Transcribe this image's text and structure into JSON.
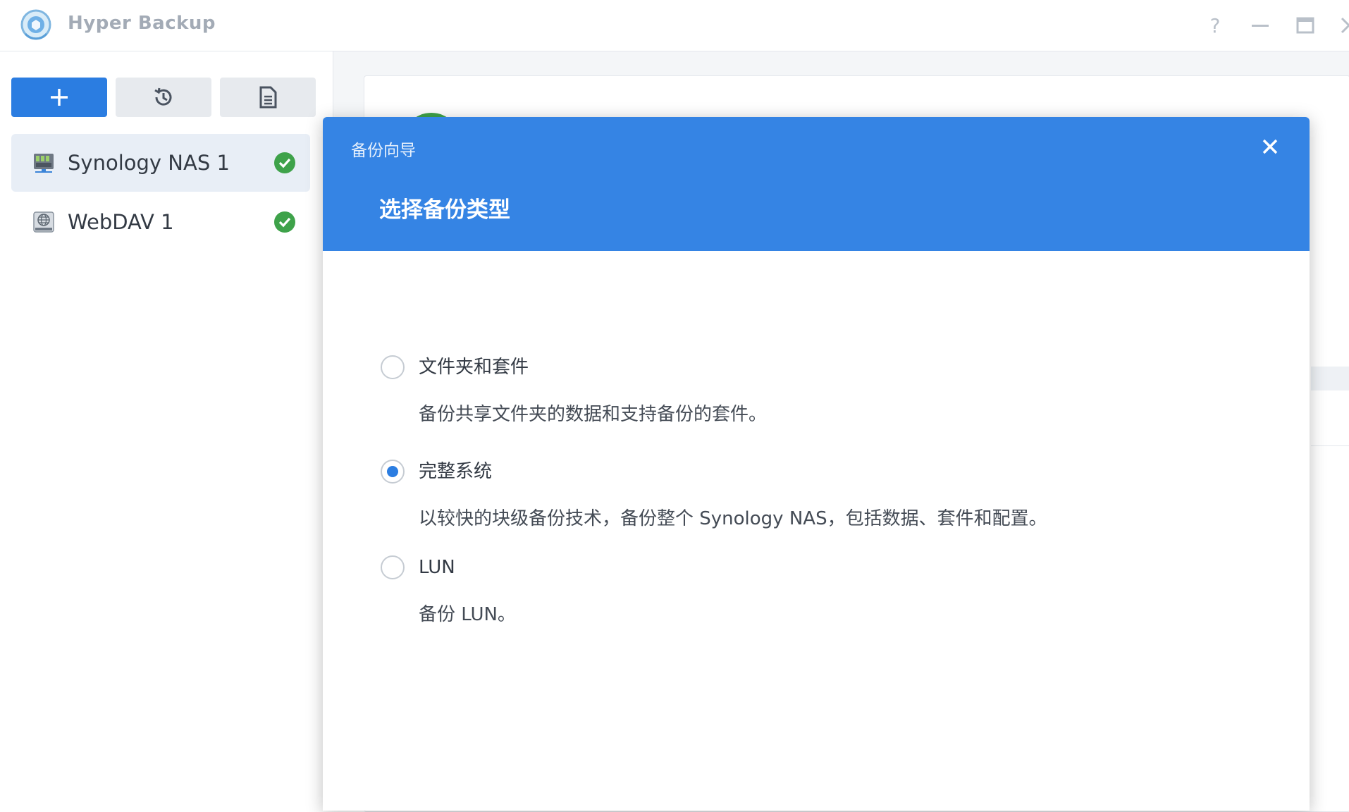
{
  "app": {
    "title": "Hyper Backup"
  },
  "window_controls": {
    "help_icon": "question-mark",
    "minimize_icon": "minimize",
    "maximize_icon": "maximize",
    "close_icon": "close-x"
  },
  "toolbar": {
    "add_icon": "plus",
    "restore_icon": "history-clock",
    "log_icon": "document-list"
  },
  "targets": [
    {
      "name": "Synology NAS 1",
      "icon": "nas-server",
      "status": "ok",
      "selected": true
    },
    {
      "name": "WebDAV 1",
      "icon": "webdav-globe-drive",
      "status": "ok",
      "selected": false
    }
  ],
  "dialog": {
    "wizard_title": "备份向导",
    "step_title": "选择备份类型",
    "options": [
      {
        "label": "文件夹和套件",
        "description": "备份共享文件夹的数据和支持备份的套件。",
        "checked": false
      },
      {
        "label": "完整系统",
        "description": "以较快的块级备份技术，备份整个 Synology NAS，包括数据、套件和配置。",
        "checked": true
      },
      {
        "label": "LUN",
        "description": "备份 LUN。",
        "checked": false
      }
    ]
  },
  "colors": {
    "accent": "#2b7de1",
    "dialog_header": "#3584e4",
    "status_ok": "#3ea24a",
    "selected_row": "#e8eef6"
  }
}
